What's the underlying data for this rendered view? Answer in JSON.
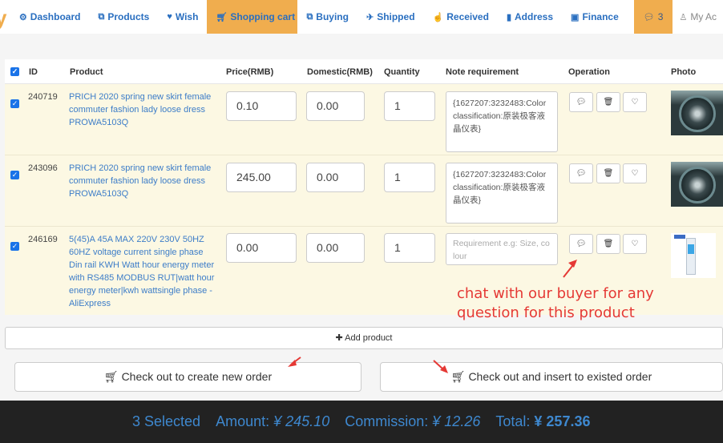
{
  "nav": {
    "items": [
      {
        "label": "Dashboard",
        "icon": "dashboard-icon"
      },
      {
        "label": "Products",
        "icon": "cubes-icon"
      },
      {
        "label": "Wish",
        "icon": "heart-icon"
      },
      {
        "label": "Shopping cart",
        "icon": "cart-icon",
        "active": true
      },
      {
        "label": "Buying",
        "icon": "cubes-icon"
      },
      {
        "label": "Shipped",
        "icon": "plane-icon"
      },
      {
        "label": "Received",
        "icon": "thumbs-up-icon"
      },
      {
        "label": "Address",
        "icon": "bookmark-icon"
      },
      {
        "label": "Finance",
        "icon": "money-icon"
      }
    ],
    "message_count": "3",
    "account_label": "My Ac",
    "accent_color": "#f0ad4e"
  },
  "table": {
    "headers": {
      "id": "ID",
      "product": "Product",
      "price": "Price(RMB)",
      "domestic": "Domestic(RMB)",
      "quantity": "Quantity",
      "note": "Note requirement",
      "operation": "Operation",
      "photo": "Photo"
    },
    "rows": [
      {
        "id": "240719",
        "product": "PRICH 2020 spring new skirt female commuter fashion lady loose dress PROWA5103Q",
        "price": "0.10",
        "domestic": "0.00",
        "quantity": "1",
        "note": "{1627207:3232483:Color classification:原装极客液晶仪表}",
        "note_placeholder": "",
        "checked": true
      },
      {
        "id": "243096",
        "product": "PRICH 2020 spring new skirt female commuter fashion lady loose dress PROWA5103Q",
        "price": "245.00",
        "domestic": "0.00",
        "quantity": "1",
        "note": "{1627207:3232483:Color classification:原装极客液晶仪表}",
        "note_placeholder": "",
        "checked": true
      },
      {
        "id": "246169",
        "product": "5(45)A 45A MAX 220V 230V 50HZ 60HZ voltage current single phase Din rail KWH Watt hour energy meter with RS485 MODBUS RUT|watt hour energy meter|kwh wattsingle phase - AliExpress",
        "price": "0.00",
        "domestic": "0.00",
        "quantity": "1",
        "note": "",
        "note_placeholder": "Requirement e.g: Size, colour",
        "checked": true
      }
    ]
  },
  "actions": {
    "add_product": "Add product",
    "checkout_new": "Check out to create new order",
    "checkout_existing": "Check out and insert to existed order"
  },
  "annotation": {
    "line1": "chat with our buyer for any",
    "line2": "question for this product",
    "color": "#e53935"
  },
  "summary": {
    "selected": "3 Selected",
    "amount_label": "Amount:",
    "amount": "¥ 245.10",
    "commission_label": "Commission:",
    "commission": "¥ 12.26",
    "total_label": "Total:",
    "total": "¥ 257.36"
  }
}
